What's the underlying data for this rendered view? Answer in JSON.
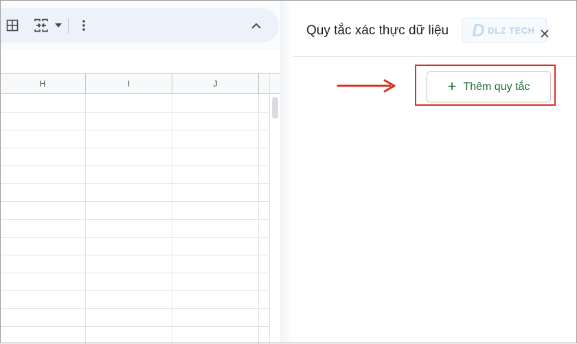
{
  "spreadsheet": {
    "toolbar": {
      "icons": [
        "borders-icon",
        "merge-cells-icon",
        "dropdown-caret-icon",
        "more-vert-icon",
        "collapse-chevron-up-icon"
      ]
    },
    "columns": [
      "H",
      "I",
      "J"
    ]
  },
  "side_panel": {
    "title": "Quy tắc xác thực dữ liệu",
    "close_icon": "close-icon",
    "add_rule_label": "Thêm quy tắc",
    "add_rule_icon": "plus-icon",
    "watermark": {
      "mark": "D",
      "text": "DLZ TECH"
    }
  },
  "annotations": {
    "arrow_color": "#d93025",
    "highlight_color": "#d93025"
  },
  "colors": {
    "accent_green": "#146c2e",
    "toolbar_bg": "#edf2fa",
    "grid_line": "#e2e3e3"
  }
}
